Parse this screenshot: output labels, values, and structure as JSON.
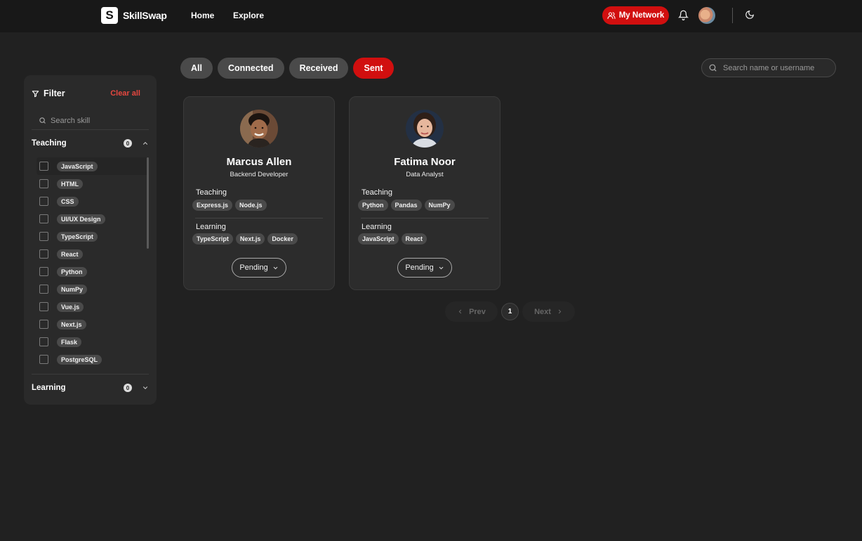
{
  "navbar": {
    "logo_mark": "S",
    "brand": "SkillSwap",
    "links": [
      "Home",
      "Explore"
    ],
    "network_button": "My Network",
    "accent_color": "#d10f0f"
  },
  "sidebar": {
    "title": "Filter",
    "clear_all": "Clear all",
    "search_placeholder": "Search skill",
    "teaching": {
      "label": "Teaching",
      "count": "0"
    },
    "learning": {
      "label": "Learning",
      "count": "0"
    },
    "skills": [
      "JavaScript",
      "HTML",
      "CSS",
      "UI/UX Design",
      "TypeScript",
      "React",
      "Python",
      "NumPy",
      "Vue.js",
      "Next.js",
      "Flask",
      "PostgreSQL"
    ]
  },
  "tabs": {
    "items": [
      "All",
      "Connected",
      "Received",
      "Sent"
    ],
    "active": "Sent"
  },
  "search": {
    "placeholder": "Search name or username"
  },
  "cards": [
    {
      "name": "Marcus Allen",
      "role": "Backend Developer",
      "teaching_label": "Teaching",
      "teaching": [
        "Express.js",
        "Node.js"
      ],
      "learning_label": "Learning",
      "learning": [
        "TypeScript",
        "Next.js",
        "Docker"
      ],
      "status": "Pending"
    },
    {
      "name": "Fatima Noor",
      "role": "Data Analyst",
      "teaching_label": "Teaching",
      "teaching": [
        "Python",
        "Pandas",
        "NumPy"
      ],
      "learning_label": "Learning",
      "learning": [
        "JavaScript",
        "React"
      ],
      "status": "Pending"
    }
  ],
  "pagination": {
    "prev": "Prev",
    "current": "1",
    "next": "Next"
  }
}
